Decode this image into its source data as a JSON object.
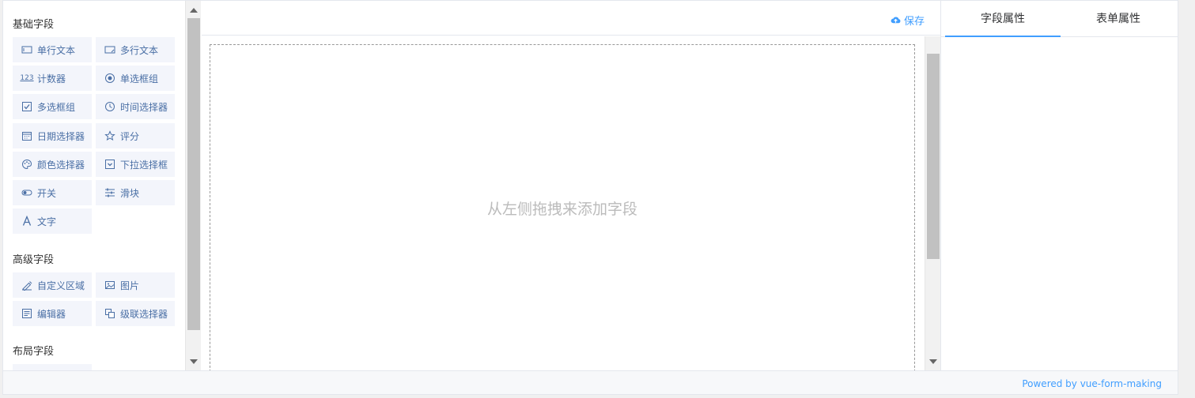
{
  "sidebar": {
    "basic_title": "基础字段",
    "advanced_title": "高级字段",
    "layout_title": "布局字段",
    "basic_fields": [
      {
        "label": "单行文本",
        "icon": "input-icon"
      },
      {
        "label": "多行文本",
        "icon": "textarea-icon"
      },
      {
        "label": "计数器",
        "icon": "number-icon"
      },
      {
        "label": "单选框组",
        "icon": "radio-icon"
      },
      {
        "label": "多选框组",
        "icon": "checkbox-icon"
      },
      {
        "label": "时间选择器",
        "icon": "clock-icon"
      },
      {
        "label": "日期选择器",
        "icon": "calendar-icon"
      },
      {
        "label": "评分",
        "icon": "star-icon"
      },
      {
        "label": "颜色选择器",
        "icon": "palette-icon"
      },
      {
        "label": "下拉选择框",
        "icon": "select-icon"
      },
      {
        "label": "开关",
        "icon": "switch-icon"
      },
      {
        "label": "滑块",
        "icon": "slider-icon"
      },
      {
        "label": "文字",
        "icon": "text-icon"
      }
    ],
    "advanced_fields": [
      {
        "label": "自定义区域",
        "icon": "custom-icon"
      },
      {
        "label": "图片",
        "icon": "image-icon"
      },
      {
        "label": "编辑器",
        "icon": "editor-icon"
      },
      {
        "label": "级联选择器",
        "icon": "cascader-icon"
      }
    ]
  },
  "toolbar": {
    "save_label": "保存",
    "number_icon_text": "123"
  },
  "canvas": {
    "placeholder": "从左侧拖拽来添加字段"
  },
  "config_tabs": {
    "field_props": "字段属性",
    "form_props": "表单属性"
  },
  "footer": {
    "powered_by": "Powered by vue-form-making"
  },
  "colors": {
    "accent": "#409eff",
    "button_bg": "#f3f5fb",
    "button_text": "#4a6fa5"
  }
}
